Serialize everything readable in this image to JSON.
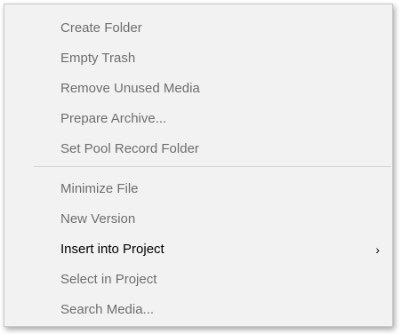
{
  "menu": {
    "group1": [
      {
        "label": "Create Folder",
        "enabled": false
      },
      {
        "label": "Empty Trash",
        "enabled": false
      },
      {
        "label": "Remove Unused Media",
        "enabled": false
      },
      {
        "label": "Prepare Archive...",
        "enabled": false
      },
      {
        "label": "Set Pool Record Folder",
        "enabled": false
      }
    ],
    "group2": [
      {
        "label": "Minimize File",
        "enabled": false
      },
      {
        "label": "New Version",
        "enabled": false
      },
      {
        "label": "Insert into Project",
        "enabled": true,
        "submenu_arrow": "›"
      },
      {
        "label": "Select in Project",
        "enabled": false
      },
      {
        "label": "Search Media...",
        "enabled": false
      }
    ]
  },
  "colors": {
    "enabled_text": "#000000",
    "disabled_text": "#6e6e6e",
    "menu_bg": "#f2f2f2",
    "separator": "#d5d5d5"
  }
}
